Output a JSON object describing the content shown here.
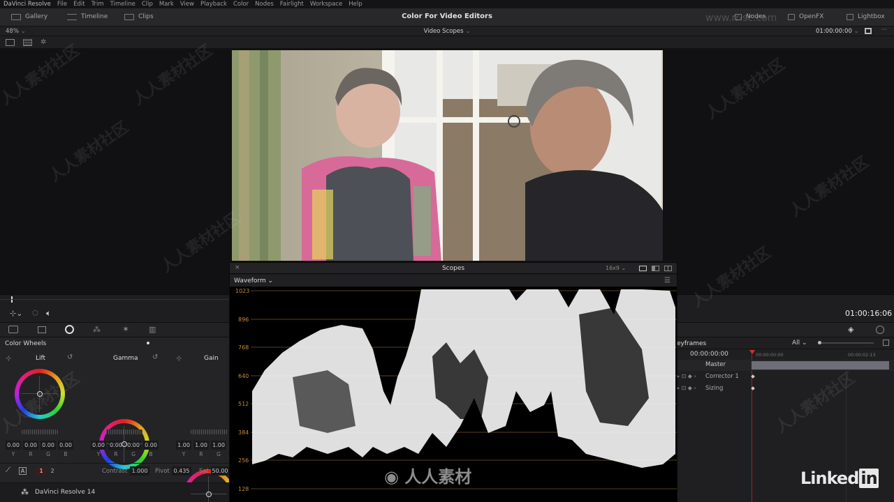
{
  "menu": {
    "app": "DaVinci Resolve",
    "items": [
      "File",
      "Edit",
      "Trim",
      "Timeline",
      "Clip",
      "Mark",
      "View",
      "Playback",
      "Color",
      "Nodes",
      "Fairlight",
      "Workspace",
      "Help"
    ]
  },
  "toolbar": {
    "gallery": "Gallery",
    "timeline": "Timeline",
    "clips": "Clips",
    "project_title": "Color For Video Editors",
    "nodes": "Nodes",
    "openfx": "OpenFX",
    "lightbox": "Lightbox"
  },
  "viewer": {
    "zoom": "48%",
    "mode": "Video Scopes",
    "timecode": "01:00:00:00"
  },
  "transport": {
    "timecode": "01:00:16:06"
  },
  "color_wheels": {
    "title": "Color Wheels",
    "lift": {
      "label": "Lift",
      "values": [
        "0.00",
        "0.00",
        "0.00",
        "0.00"
      ]
    },
    "gamma": {
      "label": "Gamma",
      "values": [
        "0.00",
        "0.00",
        "0.00",
        "0.00"
      ]
    },
    "gain": {
      "label": "Gain",
      "values": [
        "1.00",
        "1.00",
        "1.00"
      ]
    },
    "channels": [
      "Y",
      "R",
      "G",
      "B"
    ],
    "pages": [
      "1",
      "2"
    ],
    "contrast_label": "Contrast",
    "contrast_value": "1.000",
    "pivot_label": "Pivot",
    "pivot_value": "0.435",
    "sat_label": "Sat",
    "sat_value": "50.00"
  },
  "scopes": {
    "title": "Scopes",
    "aspect": "16x9",
    "type": "Waveform",
    "scale": [
      "1023",
      "896",
      "768",
      "640",
      "512",
      "384",
      "256",
      "128"
    ]
  },
  "keyframes": {
    "title": "eyframes",
    "filter": "All",
    "timecode": "00:00:00:00",
    "ruler_start": "00:00:00:00",
    "ruler_end": "00:00:02:13",
    "tracks": [
      "Master",
      "Corrector 1",
      "Sizing"
    ]
  },
  "footer": {
    "app_version": "DaVinci Resolve 14",
    "brand": "Linked",
    "brand_in": "in"
  },
  "watermark": {
    "text": "人人素材社区",
    "site": "www.rr-sc.com",
    "logo_text": "人人素材"
  },
  "colors": {
    "accent_red": "#d83030",
    "keyframe_bar": "#6e6e78"
  }
}
